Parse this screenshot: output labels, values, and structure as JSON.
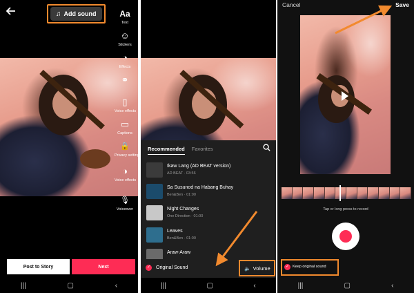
{
  "panel1": {
    "add_sound_label": "Add sound",
    "tools": [
      {
        "icon": "text-icon",
        "glyph": "Aa",
        "label": "Text"
      },
      {
        "icon": "stickers-icon",
        "glyph": "☺",
        "label": "Stickers"
      },
      {
        "icon": "effects-icon",
        "glyph": "◔",
        "label": "Effects"
      },
      {
        "icon": "filters-icon",
        "glyph": "⚭",
        "label": ""
      },
      {
        "icon": "voice-effects-icon",
        "glyph": "▯",
        "label": "Voice effects"
      },
      {
        "icon": "captions-icon",
        "glyph": "▭",
        "label": "Captions"
      },
      {
        "icon": "privacy-icon",
        "glyph": "🔒",
        "label": "Privacy settings"
      },
      {
        "icon": "voice-effects-icon",
        "glyph": "◑",
        "label": "Voice effects"
      },
      {
        "icon": "voiceover-icon",
        "glyph": "🎙",
        "label": "Voiceover"
      }
    ],
    "post_to_story_label": "Post to Story",
    "next_label": "Next"
  },
  "panel2": {
    "tabs": [
      "Recommended",
      "Favorites"
    ],
    "songs": [
      {
        "title": "Ikaw  Lang (AD BEAT version)",
        "meta": "AD BEAT · 03:56",
        "color": "#3b3b3b"
      },
      {
        "title": "Sa Susunod na Habang Buhay",
        "meta": "Ben&Ben · 01:00",
        "color": "#1b4b6b"
      },
      {
        "title": "Night Changes",
        "meta": "One Direction · 01:00",
        "color": "#c8c8c8"
      },
      {
        "title": "Leaves",
        "meta": "Ben&Ben · 01:00",
        "color": "#2e6e8e"
      },
      {
        "title": "Araw-Araw",
        "meta": "",
        "color": "#6a6a6a"
      }
    ],
    "original_sound_label": "Original Sound",
    "volume_label": "Volume"
  },
  "panel3": {
    "cancel_label": "Cancel",
    "save_label": "Save",
    "tap_text": "Tap or long press to record",
    "keep_original_label": "Keep original sound"
  },
  "colors": {
    "accent": "#fe2c55",
    "highlight": "#f28a2e"
  }
}
